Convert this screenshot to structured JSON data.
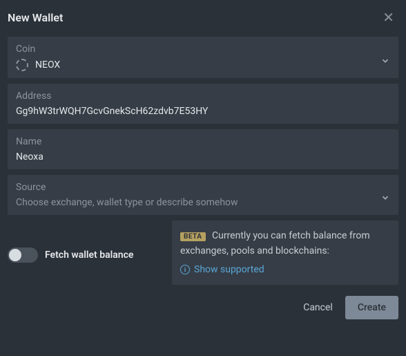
{
  "header": {
    "title": "New Wallet"
  },
  "fields": {
    "coin": {
      "label": "Coin",
      "value": "NEOX"
    },
    "address": {
      "label": "Address",
      "value": "Gg9hW3trWQH7GcvGnekScH62zdvb7E53HY"
    },
    "name": {
      "label": "Name",
      "value": "Neoxa"
    },
    "source": {
      "label": "Source",
      "placeholder": "Choose exchange, wallet type or describe somehow"
    }
  },
  "fetch": {
    "label": "Fetch wallet balance",
    "beta": "BETA",
    "info": "Currently you can fetch balance from exchanges, pools and blockchains:",
    "link": "Show supported"
  },
  "actions": {
    "cancel": "Cancel",
    "create": "Create"
  }
}
